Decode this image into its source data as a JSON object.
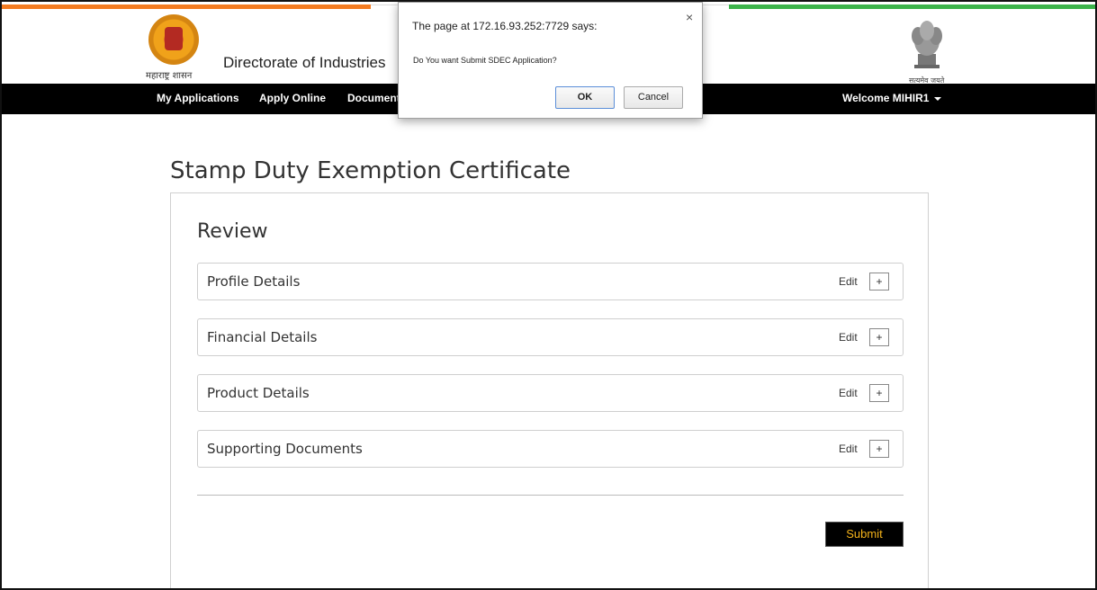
{
  "header": {
    "seal_caption": "महाराष्ट्र शासन",
    "title": "Directorate of Industries",
    "emblem_caption": "सत्यमेव जयते"
  },
  "nav": {
    "items": [
      "My Applications",
      "Apply Online",
      "Documents"
    ],
    "welcome": "Welcome MIHIR1"
  },
  "page": {
    "title": "Stamp Duty Exemption Certificate",
    "review_title": "Review",
    "sections": [
      {
        "label": "Profile Details",
        "edit": "Edit",
        "expand": "+"
      },
      {
        "label": "Financial Details",
        "edit": "Edit",
        "expand": "+"
      },
      {
        "label": "Product Details",
        "edit": "Edit",
        "expand": "+"
      },
      {
        "label": "Supporting Documents",
        "edit": "Edit",
        "expand": "+"
      }
    ],
    "submit_label": "Submit"
  },
  "dialog": {
    "title": "The page at 172.16.93.252:7729 says:",
    "close": "×",
    "message": "Do You want Submit SDEC Application?",
    "ok_label": "OK",
    "cancel_label": "Cancel"
  },
  "colors": {
    "saffron": "#f37b20",
    "green": "#3bb34a",
    "navbar": "#000000",
    "submit_text": "#f5b31a"
  }
}
